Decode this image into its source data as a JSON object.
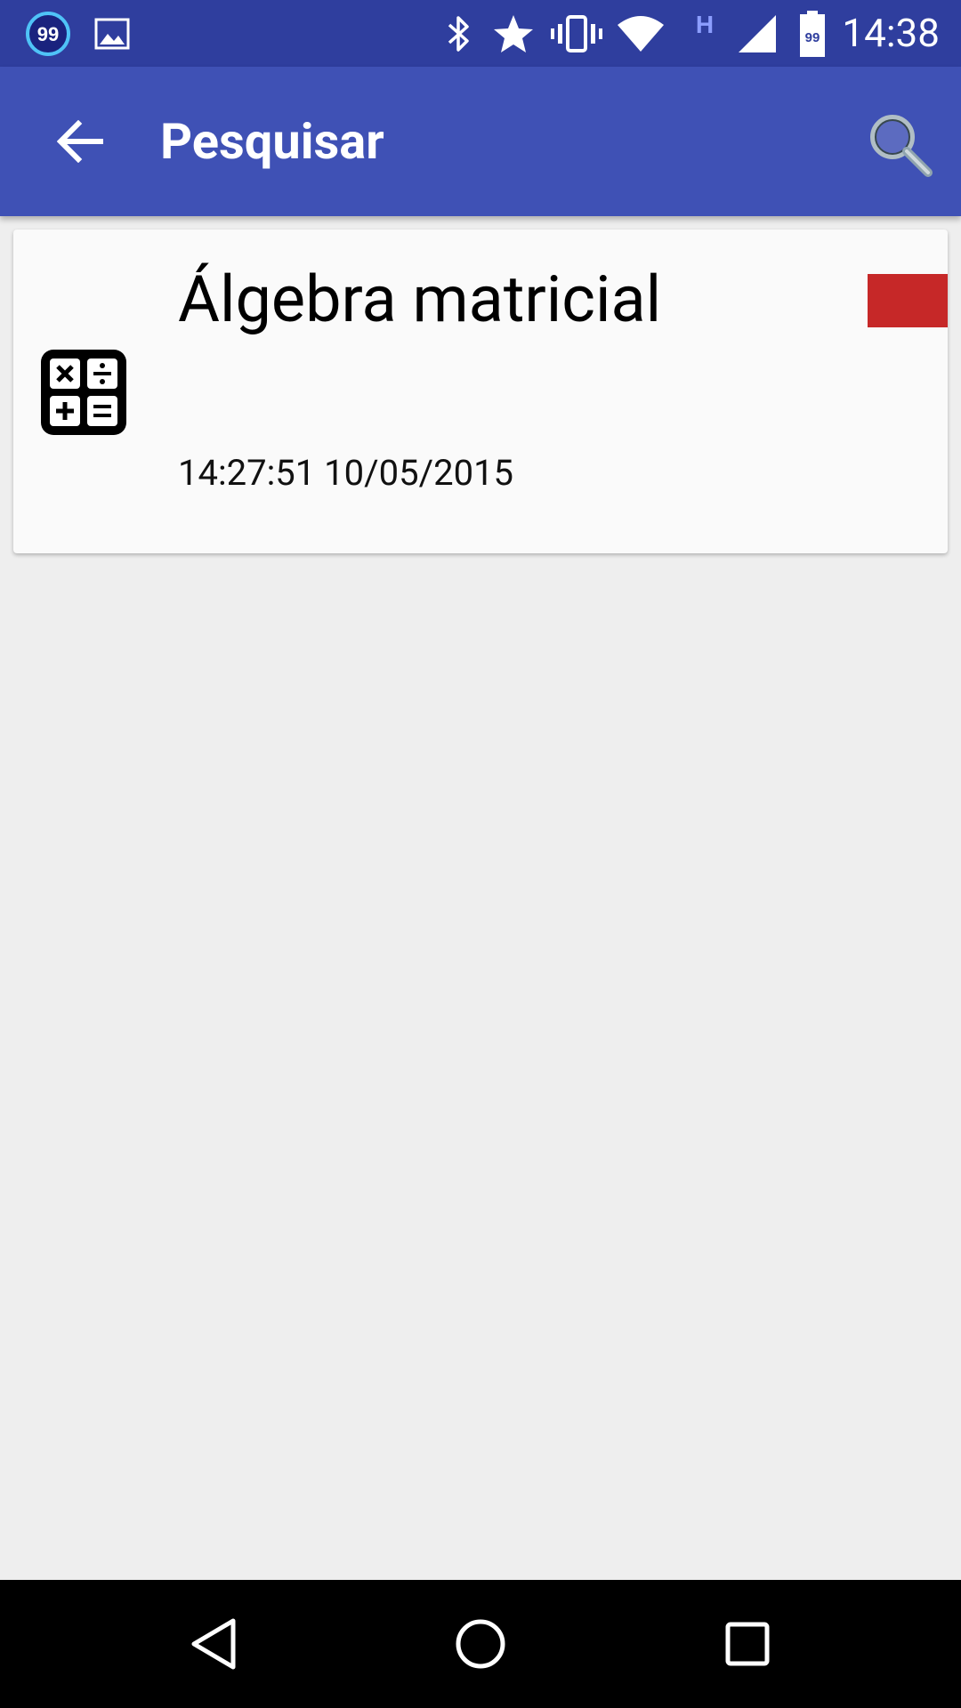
{
  "status_bar": {
    "time": "14:38",
    "notification_badge": "99",
    "battery_badge": "99",
    "network_type": "H",
    "icons": [
      "badge-99-icon",
      "image-icon",
      "bluetooth-icon",
      "star-icon",
      "vibrate-icon",
      "wifi-icon",
      "network-type-icon",
      "signal-icon",
      "battery-icon"
    ]
  },
  "app_bar": {
    "title": "Pesquisar",
    "back_icon": "arrow-back-icon",
    "search_icon": "search-icon",
    "color": "#3f51b5",
    "status_color": "#2f3e9e"
  },
  "results": [
    {
      "title": "Álgebra matricial",
      "timestamp": "14:27:51 10/05/2015",
      "icon": "calculator-icon",
      "flag_color": "#c62828"
    }
  ],
  "nav_bar": {
    "back_icon": "nav-back-icon",
    "home_icon": "nav-home-icon",
    "recents_icon": "nav-recents-icon"
  }
}
